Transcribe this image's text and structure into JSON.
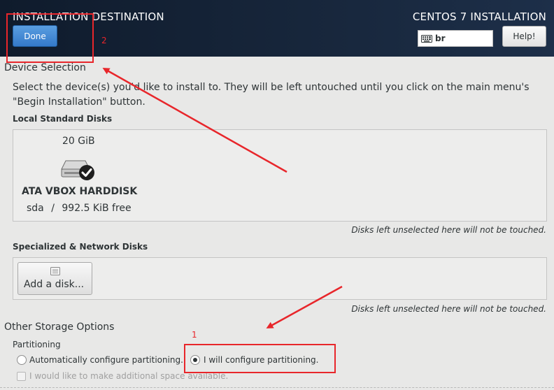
{
  "header": {
    "page_title": "INSTALLATION DESTINATION",
    "product_title": "CENTOS 7 INSTALLATION",
    "done_label": "Done",
    "keyboard_layout": "br",
    "help_label": "Help!"
  },
  "device_selection": {
    "heading": "Device Selection",
    "instruction_line1": "Select the device(s) you'd like to install to.  They will be left untouched until you click on the main menu's",
    "instruction_line2": "\"Begin Installation\" button.",
    "local_disks_heading": "Local Standard Disks",
    "disk": {
      "size": "20 GiB",
      "name": "ATA VBOX HARDDISK",
      "device": "sda",
      "separator": "/",
      "free": "992.5 KiB free",
      "selected": true
    },
    "local_note": "Disks left unselected here will not be touched.",
    "specialized_heading": "Specialized & Network Disks",
    "add_disk_label": "Add a disk...",
    "specialized_note": "Disks left unselected here will not be touched."
  },
  "other_storage": {
    "heading": "Other Storage Options",
    "partitioning_heading": "Partitioning",
    "auto_option": "Automatically configure partitioning.",
    "manual_option": "I will configure partitioning.",
    "selected_option": "manual",
    "extra_space_option": "I would like to make additional space available."
  },
  "annotations": {
    "label_1": "1",
    "label_2": "2",
    "color": "#e8262b"
  },
  "colors": {
    "header_bg": "#17263b",
    "done_button": "#3479c9",
    "annotation_red": "#e8262b"
  }
}
